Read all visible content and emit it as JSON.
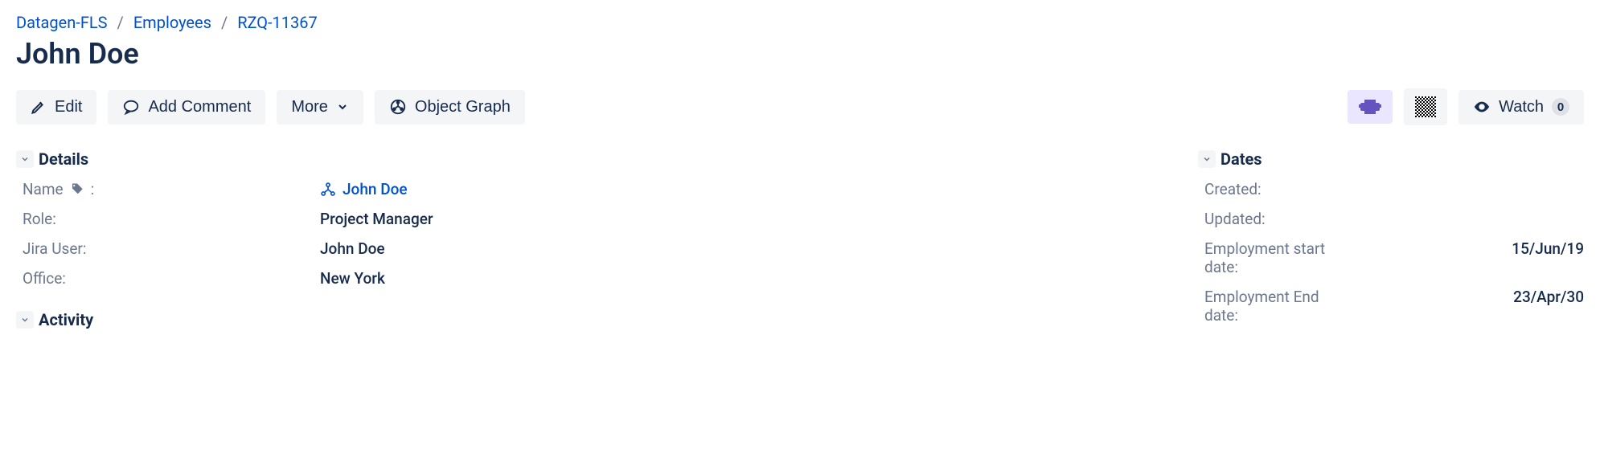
{
  "breadcrumb": {
    "items": [
      "Datagen-FLS",
      "Employees",
      "RZQ-11367"
    ]
  },
  "title": "John Doe",
  "toolbar": {
    "edit": "Edit",
    "add_comment": "Add Comment",
    "more": "More",
    "object_graph": "Object Graph",
    "watch": "Watch",
    "watch_count": "0"
  },
  "details": {
    "header": "Details",
    "name_label": "Name",
    "name_value": "John Doe",
    "role_label": "Role:",
    "role_value": "Project Manager",
    "jira_user_label": "Jira User:",
    "jira_user_value": "John Doe",
    "office_label": "Office:",
    "office_value": "New York"
  },
  "activity": {
    "header": "Activity"
  },
  "dates": {
    "header": "Dates",
    "created_label": "Created:",
    "updated_label": "Updated:",
    "emp_start_label": "Employment start date:",
    "emp_start_value": "15/Jun/19",
    "emp_end_label": "Employment End date:",
    "emp_end_value": "23/Apr/30"
  }
}
